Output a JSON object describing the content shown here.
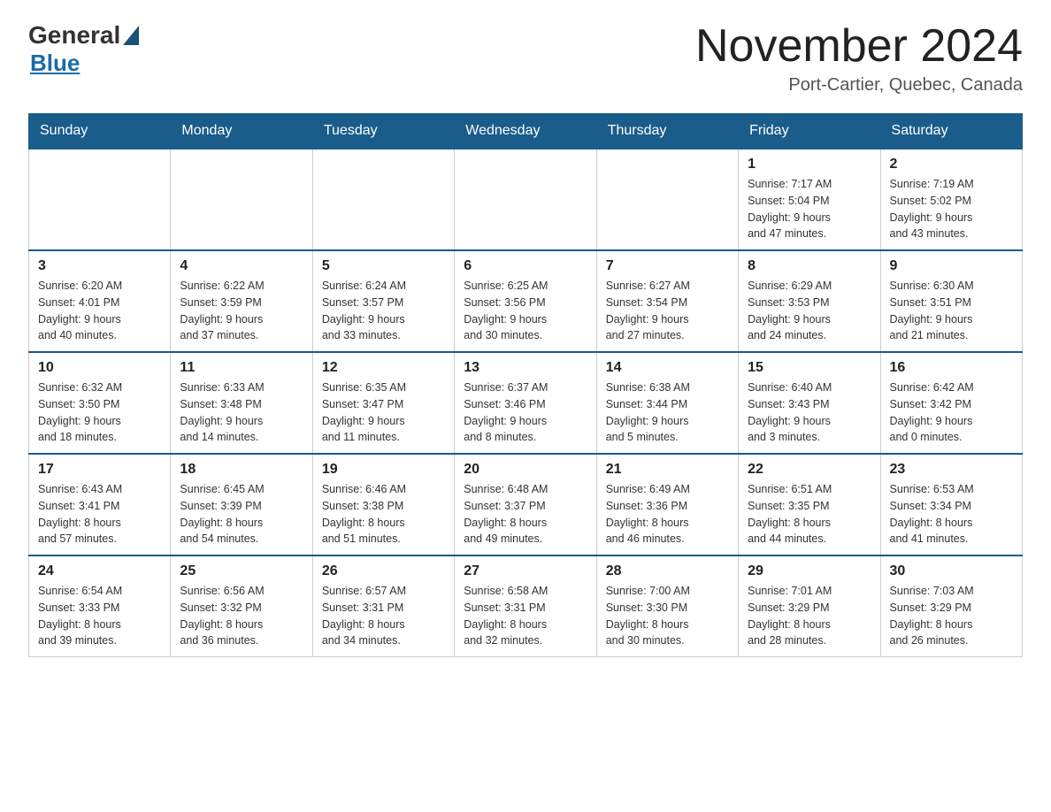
{
  "header": {
    "logo": {
      "general": "General",
      "blue": "Blue"
    },
    "title": "November 2024",
    "subtitle": "Port-Cartier, Quebec, Canada"
  },
  "weekdays": [
    "Sunday",
    "Monday",
    "Tuesday",
    "Wednesday",
    "Thursday",
    "Friday",
    "Saturday"
  ],
  "weeks": [
    [
      {
        "day": "",
        "info": ""
      },
      {
        "day": "",
        "info": ""
      },
      {
        "day": "",
        "info": ""
      },
      {
        "day": "",
        "info": ""
      },
      {
        "day": "",
        "info": ""
      },
      {
        "day": "1",
        "info": "Sunrise: 7:17 AM\nSunset: 5:04 PM\nDaylight: 9 hours\nand 47 minutes."
      },
      {
        "day": "2",
        "info": "Sunrise: 7:19 AM\nSunset: 5:02 PM\nDaylight: 9 hours\nand 43 minutes."
      }
    ],
    [
      {
        "day": "3",
        "info": "Sunrise: 6:20 AM\nSunset: 4:01 PM\nDaylight: 9 hours\nand 40 minutes."
      },
      {
        "day": "4",
        "info": "Sunrise: 6:22 AM\nSunset: 3:59 PM\nDaylight: 9 hours\nand 37 minutes."
      },
      {
        "day": "5",
        "info": "Sunrise: 6:24 AM\nSunset: 3:57 PM\nDaylight: 9 hours\nand 33 minutes."
      },
      {
        "day": "6",
        "info": "Sunrise: 6:25 AM\nSunset: 3:56 PM\nDaylight: 9 hours\nand 30 minutes."
      },
      {
        "day": "7",
        "info": "Sunrise: 6:27 AM\nSunset: 3:54 PM\nDaylight: 9 hours\nand 27 minutes."
      },
      {
        "day": "8",
        "info": "Sunrise: 6:29 AM\nSunset: 3:53 PM\nDaylight: 9 hours\nand 24 minutes."
      },
      {
        "day": "9",
        "info": "Sunrise: 6:30 AM\nSunset: 3:51 PM\nDaylight: 9 hours\nand 21 minutes."
      }
    ],
    [
      {
        "day": "10",
        "info": "Sunrise: 6:32 AM\nSunset: 3:50 PM\nDaylight: 9 hours\nand 18 minutes."
      },
      {
        "day": "11",
        "info": "Sunrise: 6:33 AM\nSunset: 3:48 PM\nDaylight: 9 hours\nand 14 minutes."
      },
      {
        "day": "12",
        "info": "Sunrise: 6:35 AM\nSunset: 3:47 PM\nDaylight: 9 hours\nand 11 minutes."
      },
      {
        "day": "13",
        "info": "Sunrise: 6:37 AM\nSunset: 3:46 PM\nDaylight: 9 hours\nand 8 minutes."
      },
      {
        "day": "14",
        "info": "Sunrise: 6:38 AM\nSunset: 3:44 PM\nDaylight: 9 hours\nand 5 minutes."
      },
      {
        "day": "15",
        "info": "Sunrise: 6:40 AM\nSunset: 3:43 PM\nDaylight: 9 hours\nand 3 minutes."
      },
      {
        "day": "16",
        "info": "Sunrise: 6:42 AM\nSunset: 3:42 PM\nDaylight: 9 hours\nand 0 minutes."
      }
    ],
    [
      {
        "day": "17",
        "info": "Sunrise: 6:43 AM\nSunset: 3:41 PM\nDaylight: 8 hours\nand 57 minutes."
      },
      {
        "day": "18",
        "info": "Sunrise: 6:45 AM\nSunset: 3:39 PM\nDaylight: 8 hours\nand 54 minutes."
      },
      {
        "day": "19",
        "info": "Sunrise: 6:46 AM\nSunset: 3:38 PM\nDaylight: 8 hours\nand 51 minutes."
      },
      {
        "day": "20",
        "info": "Sunrise: 6:48 AM\nSunset: 3:37 PM\nDaylight: 8 hours\nand 49 minutes."
      },
      {
        "day": "21",
        "info": "Sunrise: 6:49 AM\nSunset: 3:36 PM\nDaylight: 8 hours\nand 46 minutes."
      },
      {
        "day": "22",
        "info": "Sunrise: 6:51 AM\nSunset: 3:35 PM\nDaylight: 8 hours\nand 44 minutes."
      },
      {
        "day": "23",
        "info": "Sunrise: 6:53 AM\nSunset: 3:34 PM\nDaylight: 8 hours\nand 41 minutes."
      }
    ],
    [
      {
        "day": "24",
        "info": "Sunrise: 6:54 AM\nSunset: 3:33 PM\nDaylight: 8 hours\nand 39 minutes."
      },
      {
        "day": "25",
        "info": "Sunrise: 6:56 AM\nSunset: 3:32 PM\nDaylight: 8 hours\nand 36 minutes."
      },
      {
        "day": "26",
        "info": "Sunrise: 6:57 AM\nSunset: 3:31 PM\nDaylight: 8 hours\nand 34 minutes."
      },
      {
        "day": "27",
        "info": "Sunrise: 6:58 AM\nSunset: 3:31 PM\nDaylight: 8 hours\nand 32 minutes."
      },
      {
        "day": "28",
        "info": "Sunrise: 7:00 AM\nSunset: 3:30 PM\nDaylight: 8 hours\nand 30 minutes."
      },
      {
        "day": "29",
        "info": "Sunrise: 7:01 AM\nSunset: 3:29 PM\nDaylight: 8 hours\nand 28 minutes."
      },
      {
        "day": "30",
        "info": "Sunrise: 7:03 AM\nSunset: 3:29 PM\nDaylight: 8 hours\nand 26 minutes."
      }
    ]
  ]
}
